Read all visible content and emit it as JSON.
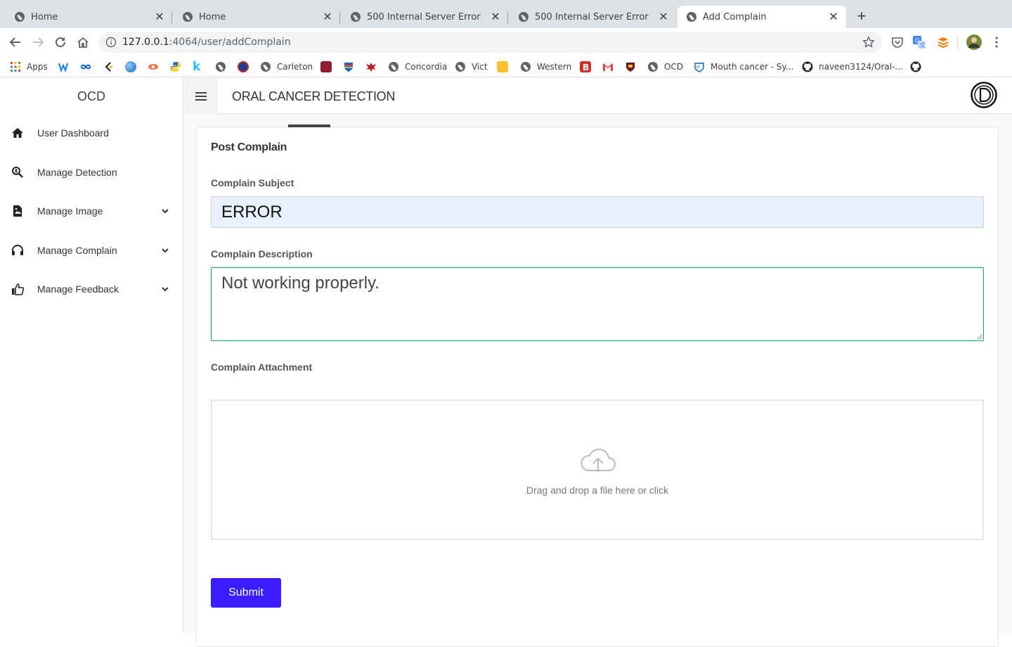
{
  "browser": {
    "tabs": [
      {
        "title": "Home"
      },
      {
        "title": "Home"
      },
      {
        "title": "500 Internal Server Error"
      },
      {
        "title": "500 Internal Server Error"
      },
      {
        "title": "Add Complain"
      }
    ],
    "url_host": "127.0.0.1",
    "url_path": ":4064/user/addComplain",
    "bookmarks": {
      "apps": "Apps",
      "carleton": "Carleton",
      "concordia": "Concordia",
      "vict": "Vict",
      "western": "Western",
      "ocd": "OCD",
      "mouth_cancer": "Mouth cancer - Sy...",
      "github_repo": "naveen3124/Oral-..."
    }
  },
  "sidebar": {
    "brand": "OCD",
    "items": [
      {
        "label": "User Dashboard",
        "icon": "home-icon"
      },
      {
        "label": "Manage Detection",
        "icon": "search-person-icon"
      },
      {
        "label": "Manage Image",
        "icon": "image-file-icon"
      },
      {
        "label": "Manage Complain",
        "icon": "headset-icon"
      },
      {
        "label": "Manage Feedback",
        "icon": "thumbs-up-icon"
      }
    ]
  },
  "header": {
    "title": "ORAL CANCER DETECTION"
  },
  "form": {
    "title": "Post Complain",
    "subject_label": "Complain Subject",
    "subject_value": "ERROR",
    "description_label": "Complain Description",
    "description_value": "Not working properly.",
    "attachment_label": "Complain Attachment",
    "dropzone_message": "Drag and drop a file here or click",
    "submit_label": "Submit"
  },
  "colors": {
    "submit_bg": "#3a1cff",
    "description_border": "#28a745",
    "subject_bg": "#e8f0fe"
  }
}
